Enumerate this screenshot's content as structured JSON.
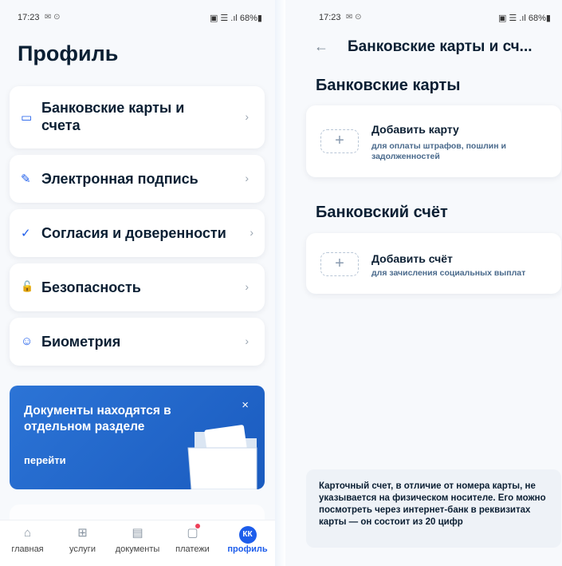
{
  "left_screen": {
    "status_bar": {
      "time": "17:23",
      "time_icons": "✉ ⊙",
      "system": "▣ ☰ .ıl 68%▮"
    },
    "title": "Профиль",
    "menu": [
      {
        "icon": "card-icon",
        "glyph": "▭",
        "label": "Банковские карты и счета"
      },
      {
        "icon": "pen-icon",
        "glyph": "✎",
        "label": "Электронная подпись"
      },
      {
        "icon": "check-circle-icon",
        "glyph": "✓",
        "label": "Согласия и доверенности"
      },
      {
        "icon": "lock-icon",
        "glyph": "🔓",
        "label": "Безопасность"
      },
      {
        "icon": "face-scan-icon",
        "glyph": "☺",
        "label": "Биометрия"
      }
    ],
    "banner": {
      "title": "Документы находятся в отдельном разделе",
      "link": "перейти",
      "close": "×"
    },
    "tabbar": [
      {
        "icon": "home-icon",
        "glyph": "⌂",
        "label": "главная",
        "active": false
      },
      {
        "icon": "services-icon",
        "glyph": "⊞",
        "label": "услуги",
        "active": false
      },
      {
        "icon": "documents-icon",
        "glyph": "▤",
        "label": "документы",
        "active": false
      },
      {
        "icon": "payments-icon",
        "glyph": "▢",
        "label": "платежи",
        "active": false
      },
      {
        "icon": "profile-avatar",
        "glyph": "КК",
        "label": "профиль",
        "active": true
      }
    ]
  },
  "right_screen": {
    "status_bar": {
      "time": "17:23",
      "time_icons": "✉ ⊙",
      "system": "▣ ☰ .ıl 68%▮"
    },
    "back_glyph": "←",
    "title": "Банковские карты и сч...",
    "cards_section": {
      "heading": "Банковские карты",
      "add_title": "Добавить карту",
      "add_sub": "для оплаты штрафов, пошлин и задолженностей"
    },
    "account_section": {
      "heading": "Банковский счёт",
      "add_title": "Добавить счёт",
      "add_sub": "для зачисления социальных выплат"
    },
    "plus_glyph": "+",
    "info": "Карточный счет, в отличие от номера карты, не указывается на физическом носителе. Его можно посмотреть через интернет-банк в реквизитах карты — он состоит из 20 цифр"
  },
  "colors": {
    "accent": "#1d5deb",
    "banner": "#2c74d6",
    "text": "#0b1f33",
    "notify_dot": "#ee3f58"
  }
}
